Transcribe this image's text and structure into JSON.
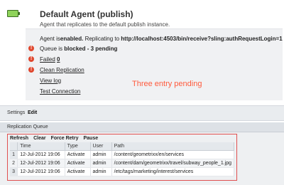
{
  "agent": {
    "title": "Default Agent (publish)",
    "description": "Agent that replicates to the default publish instance."
  },
  "status": {
    "enabled_prefix": "Agent is ",
    "enabled_word": "enabled.",
    "replicating_prefix": " Replicating to ",
    "url": "http://localhost:4503/bin/receive?sling:authRequestLogin=1",
    "queue_prefix": "Queue is ",
    "queue_state": "blocked - 3 pending",
    "failed_label": "Failed",
    "failed_count": "0",
    "clean_replication": "Clean Replication",
    "view_log": "View log",
    "test_connection": "Test Connection"
  },
  "annotation": "Three entry pending",
  "settings": {
    "label": "Settings",
    "edit": "Edit"
  },
  "queue": {
    "title": "Replication Queue",
    "toolbar": [
      "Refresh",
      "Clear",
      "Force Retry",
      "Pause"
    ],
    "columns": [
      "",
      "Time",
      "Type",
      "User",
      "Path"
    ],
    "rows": [
      {
        "num": "1",
        "time": "12-Jul-2012 19:06",
        "type": "Activate",
        "user": "admin",
        "path": "/content/geometrixx/en/services"
      },
      {
        "num": "2",
        "time": "12-Jul-2012 19:06",
        "type": "Activate",
        "user": "admin",
        "path": "/content/dam/geometrixx/travel/subway_people_1.jpg"
      },
      {
        "num": "3",
        "time": "12-Jul-2012 19:06",
        "type": "Activate",
        "user": "admin",
        "path": "/etc/tags/marketing/interest/services"
      }
    ]
  },
  "colors": {
    "accent_red": "#e05050",
    "annotation": "#ff5a3c",
    "status_green": "#8fd35a"
  }
}
